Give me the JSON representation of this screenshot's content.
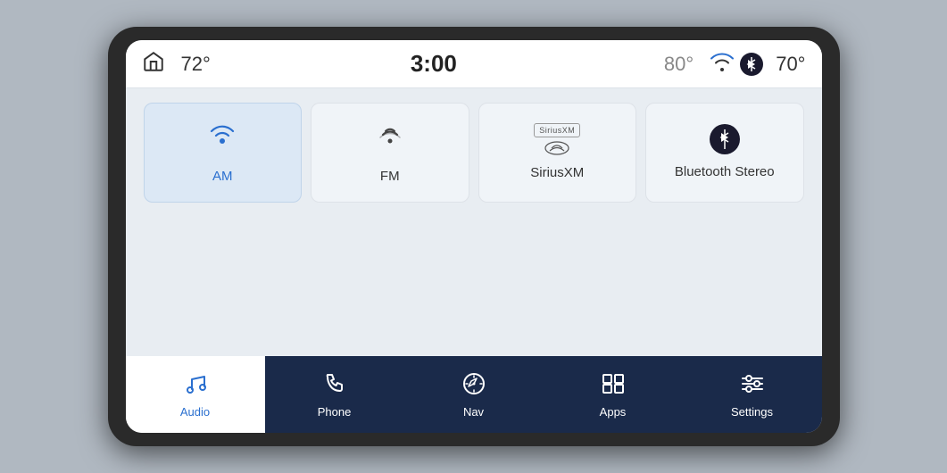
{
  "statusBar": {
    "homeIcon": "⌂",
    "tempLeft": "72°",
    "time": "3:00",
    "tempOutside": "80°",
    "wifiIcon": "wifi",
    "bluetoothIcon": "B",
    "tempRight": "70°"
  },
  "audioTiles": [
    {
      "id": "am",
      "label": "AM",
      "active": true,
      "iconType": "radio-tower"
    },
    {
      "id": "fm",
      "label": "FM",
      "active": false,
      "iconType": "radio-waves"
    },
    {
      "id": "siriusxm",
      "label": "SiriusXM",
      "active": false,
      "iconType": "sirius"
    },
    {
      "id": "bluetooth-stereo",
      "label": "Bluetooth Stereo",
      "active": false,
      "iconType": "bluetooth"
    }
  ],
  "bottomNav": [
    {
      "id": "audio",
      "label": "Audio",
      "active": true,
      "iconType": "music-note"
    },
    {
      "id": "phone",
      "label": "Phone",
      "active": false,
      "iconType": "phone"
    },
    {
      "id": "nav",
      "label": "Nav",
      "active": false,
      "iconType": "compass"
    },
    {
      "id": "apps",
      "label": "Apps",
      "active": false,
      "iconType": "apps-grid"
    },
    {
      "id": "settings",
      "label": "Settings",
      "active": false,
      "iconType": "sliders"
    }
  ]
}
